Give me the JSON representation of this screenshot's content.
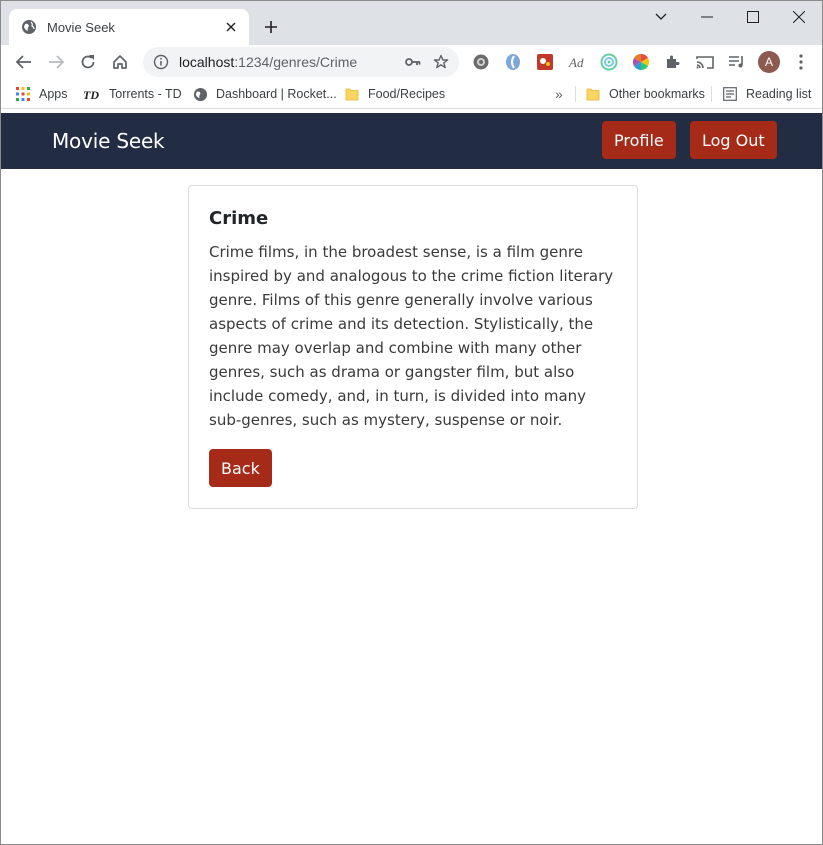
{
  "browser": {
    "tab": {
      "title": "Movie Seek"
    },
    "address": {
      "host": "localhost",
      "path": ":1234/genres/Crime"
    },
    "profile_initial": "A",
    "bookmarks": [
      {
        "label": "Apps"
      },
      {
        "label": "Torrents - TD"
      },
      {
        "label": "Dashboard | Rocket..."
      },
      {
        "label": "Food/Recipes"
      }
    ],
    "overflow": "»",
    "other_bookmarks": "Other bookmarks",
    "reading_list": "Reading list"
  },
  "app": {
    "brand": "Movie Seek",
    "nav": {
      "profile_label": "Profile",
      "logout_label": "Log Out"
    },
    "colors": {
      "navbar": "#222c43",
      "accent": "#a52a17"
    }
  },
  "genre": {
    "title": "Crime",
    "description": "Crime films, in the broadest sense, is a film genre inspired by and analogous to the crime fiction literary genre. Films of this genre generally involve various aspects of crime and its detection. Stylistically, the genre may overlap and combine with many other genres, such as drama or gangster film, but also include comedy, and, in turn, is divided into many sub-genres, such as mystery, suspense or noir.",
    "back_label": "Back"
  }
}
